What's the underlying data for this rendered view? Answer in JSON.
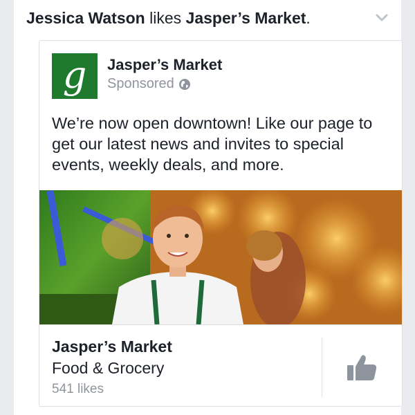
{
  "story": {
    "actor": "Jessica Watson",
    "verb": "likes",
    "page": "Jasper’s Market",
    "punct": "."
  },
  "ad": {
    "logo_letter": "g",
    "page_name": "Jasper’s Market",
    "sponsored": "Sponsored",
    "message": "We’re now open downtown! Like our page to get our latest news and invites to special events, weekly deals, and more.",
    "footer": {
      "name": "Jasper’s Market",
      "category": "Food & Grocery",
      "likes": "541 likes"
    }
  },
  "colors": {
    "brand_green": "#1f7a2e",
    "muted_text": "#90949c",
    "icon_gray": "#8d949e"
  },
  "icons": [
    "chevron-down-icon",
    "globe-icon",
    "thumbs-up-icon"
  ]
}
